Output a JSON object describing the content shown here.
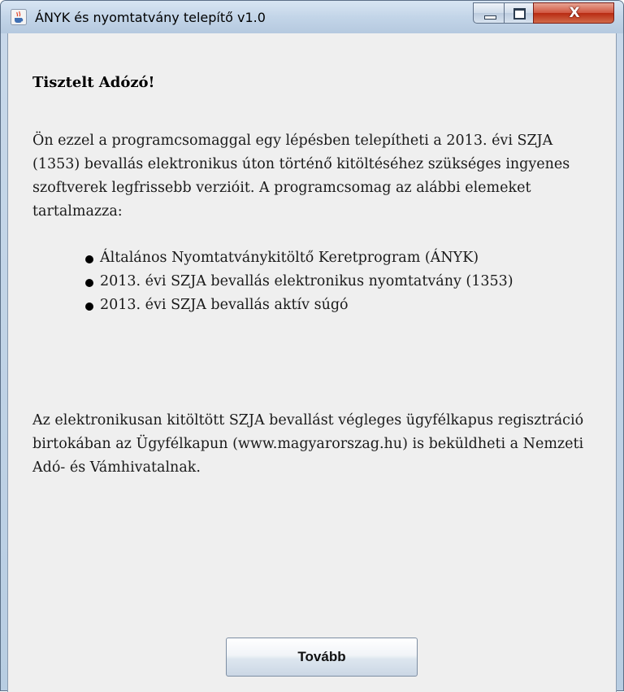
{
  "window": {
    "title": "ÁNYK és nyomtatvány telepítő v1.0",
    "controls": {
      "minimize": "minimize-icon",
      "maximize": "maximize-icon",
      "close": "close-icon",
      "close_glyph": "X"
    },
    "app_icon": "java-cup-icon"
  },
  "main": {
    "greeting": "Tisztelt Adózó!",
    "intro": "Ön ezzel a programcsomaggal egy lépésben telepítheti a 2013. évi SZJA (1353) bevallás elektronikus úton történő kitöltéséhez szükséges ingyenes szoftverek legfrissebb verzióit. A programcsomag az alábbi elemeket tartalmazza:",
    "items": [
      "Általános Nyomtatványkitöltő Keretprogram (ÁNYK)",
      "2013. évi SZJA bevallás elektronikus nyomtatvány (1353)",
      "2013. évi SZJA bevallás aktív súgó"
    ],
    "note": "Az elektronikusan kitöltött SZJA bevallást végleges ügyfélkapus regisztráció birtokában az Ügyfélkapun (www.magyarorszag.hu) is beküldheti a Nemzeti Adó- és Vámhivatalnak."
  },
  "footer": {
    "next_label": "Tovább"
  }
}
